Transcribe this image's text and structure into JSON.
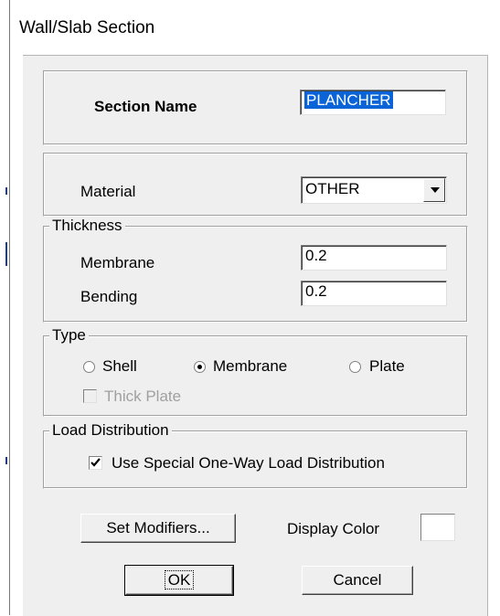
{
  "dialog": {
    "title": "Wall/Slab Section"
  },
  "section_name": {
    "label": "Section Name",
    "value": "PLANCHER"
  },
  "material": {
    "label": "Material",
    "selected": "OTHER"
  },
  "thickness": {
    "legend": "Thickness",
    "membrane_label": "Membrane",
    "membrane_value": "0.2",
    "bending_label": "Bending",
    "bending_value": "0.2"
  },
  "type": {
    "legend": "Type",
    "options": [
      "Shell",
      "Membrane",
      "Plate"
    ],
    "selected": "Membrane",
    "thick_plate_label": "Thick Plate",
    "thick_plate_checked": false,
    "thick_plate_enabled": false
  },
  "load_distribution": {
    "legend": "Load Distribution",
    "checkbox_label": "Use Special One-Way Load Distribution",
    "checked": true
  },
  "buttons": {
    "set_modifiers": "Set Modifiers...",
    "display_color_label": "Display Color",
    "ok": "OK",
    "cancel": "Cancel"
  },
  "colors": {
    "selection_highlight": "#0a64d8",
    "dialog_bg": "#efefef",
    "display_color": "#ffffff"
  }
}
